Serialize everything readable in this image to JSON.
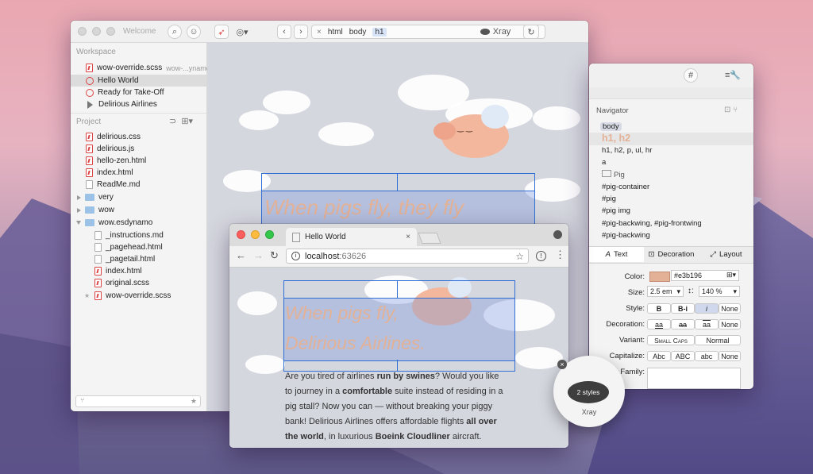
{
  "colors": {
    "accent": "#2f6fd6",
    "swatch": "#e3b196",
    "highlight": "#d8dbe6",
    "pink": "#e9a7b1"
  },
  "editor": {
    "title": "Welcome",
    "workspace_header": "Workspace",
    "workspace_items": [
      {
        "label": "wow-override.scss",
        "sub": "wow-...ynamo"
      },
      {
        "label": "Hello World"
      },
      {
        "label": "Ready for Take-Off"
      },
      {
        "label": "Delirious Airlines"
      }
    ],
    "project_header": "Project",
    "project_items": [
      {
        "label": "delirious.css"
      },
      {
        "label": "delirious.js"
      },
      {
        "label": "hello-zen.html"
      },
      {
        "label": "index.html"
      },
      {
        "label": "ReadMe.md"
      },
      {
        "label": "very"
      },
      {
        "label": "wow"
      },
      {
        "label": "wow.esdynamo"
      },
      {
        "label": "_instructions.md"
      },
      {
        "label": "_pagehead.html"
      },
      {
        "label": "_pagetail.html"
      },
      {
        "label": "index.html"
      },
      {
        "label": "original.scss"
      },
      {
        "label": "wow-override.scss"
      }
    ],
    "breadcrumb": [
      "html",
      "body",
      "h1"
    ],
    "xray_label": "Xray",
    "preview_heading": "When pigs fly, they fly"
  },
  "inspector": {
    "navigator_title": "Navigator",
    "nav_items": [
      "body",
      "h1, h2",
      "h1, h2, p, ul, hr",
      "a",
      "Pig",
      "#pig-container",
      "#pig",
      "#pig img",
      "#pig-backwing, #pig-frontwing",
      "#pig-backwing"
    ],
    "tabs": [
      "Text",
      "Decoration",
      "Layout"
    ],
    "props": {
      "color_label": "Color:",
      "color_value": "#e3b196",
      "size_label": "Size:",
      "size_value": "2.5 em",
      "line_value": "140 %",
      "style_label": "Style:",
      "style_opts": [
        "B",
        "B-i",
        "i",
        "None"
      ],
      "decoration_label": "Decoration:",
      "decoration_opts": [
        "aa",
        "aa",
        "aa",
        "None"
      ],
      "variant_label": "Variant:",
      "variant_opts": [
        "Small Caps",
        "Normal"
      ],
      "capitalize_label": "Capitalize:",
      "capitalize_opts": [
        "Abc",
        "ABC",
        "abc",
        "None"
      ],
      "family_label": "Family:"
    },
    "hash_btn": "#"
  },
  "browser": {
    "tab_title": "Hello World",
    "url_host": "localhost",
    "url_port": ":63626",
    "heading_line1": "When pigs fly,",
    "heading_line2": "Delirious Airlines.",
    "paragraph": [
      {
        "t": "Are you tired of airlines ",
        "b": false
      },
      {
        "t": "run by swines",
        "b": true
      },
      {
        "t": "? Would you like to journey in a ",
        "b": false
      },
      {
        "t": "comfortable",
        "b": true
      },
      {
        "t": " suite instead of residing in a pig stall? Now you can — without breaking your piggy bank! Delirious Airlines offers affordable flights ",
        "b": false
      },
      {
        "t": "all over the world",
        "b": true
      },
      {
        "t": ", in luxurious ",
        "b": false
      },
      {
        "t": "Boeink Cloudliner",
        "b": true
      },
      {
        "t": " aircraft.",
        "b": false
      }
    ]
  },
  "xray_popup": {
    "badge": "2 styles",
    "label": "Xray"
  }
}
